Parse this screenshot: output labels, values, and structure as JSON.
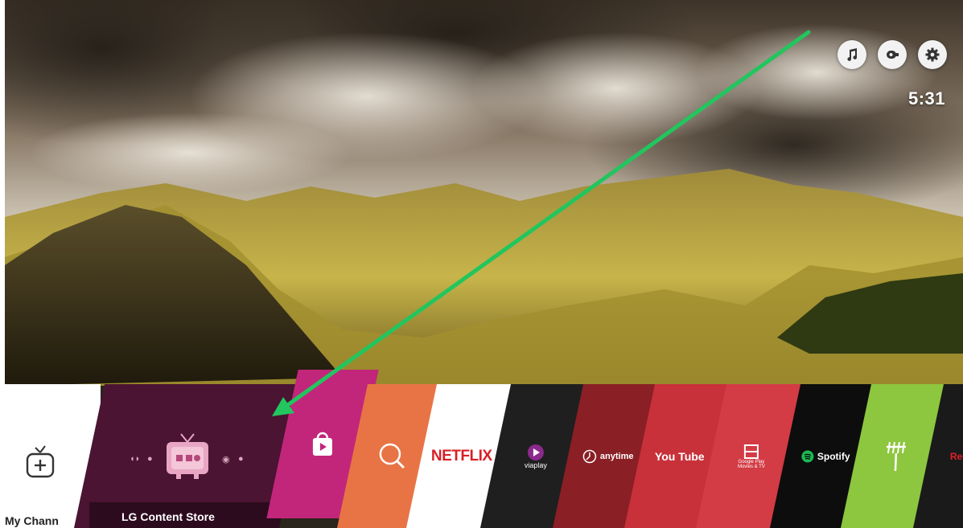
{
  "status": {
    "time": "5:31"
  },
  "top_icons": [
    "music-icon",
    "input-icon",
    "settings-icon"
  ],
  "launcher": {
    "my_channels_label": "My Chann",
    "featured_label": "LG Content Store",
    "apps": [
      {
        "name": "lg-store-shopping",
        "label": ""
      },
      {
        "name": "search",
        "label": ""
      },
      {
        "name": "netflix",
        "label": "NETFLIX"
      },
      {
        "name": "viaplay",
        "label": "viaplay"
      },
      {
        "name": "anytime",
        "label": "anytime"
      },
      {
        "name": "youtube",
        "label": "You Tube"
      },
      {
        "name": "google-play-movies",
        "label": "Google Play Movies & TV"
      },
      {
        "name": "spotify",
        "label": "Spotify"
      },
      {
        "name": "live-tv",
        "label": ""
      },
      {
        "name": "redbull",
        "label": "Red"
      }
    ]
  },
  "colors": {
    "lg_store": "#4a1432",
    "lg_store_shop": "#c2267a",
    "search": "#e87445",
    "netflix": "#ffffff",
    "viaplay": "#1f1f1f",
    "anytime": "#8a1f25",
    "youtube": "#c8313a",
    "google_play": "#d33b45",
    "spotify": "#0d0d0d",
    "livetv": "#8dc63f",
    "arrow": "#22c55e"
  }
}
